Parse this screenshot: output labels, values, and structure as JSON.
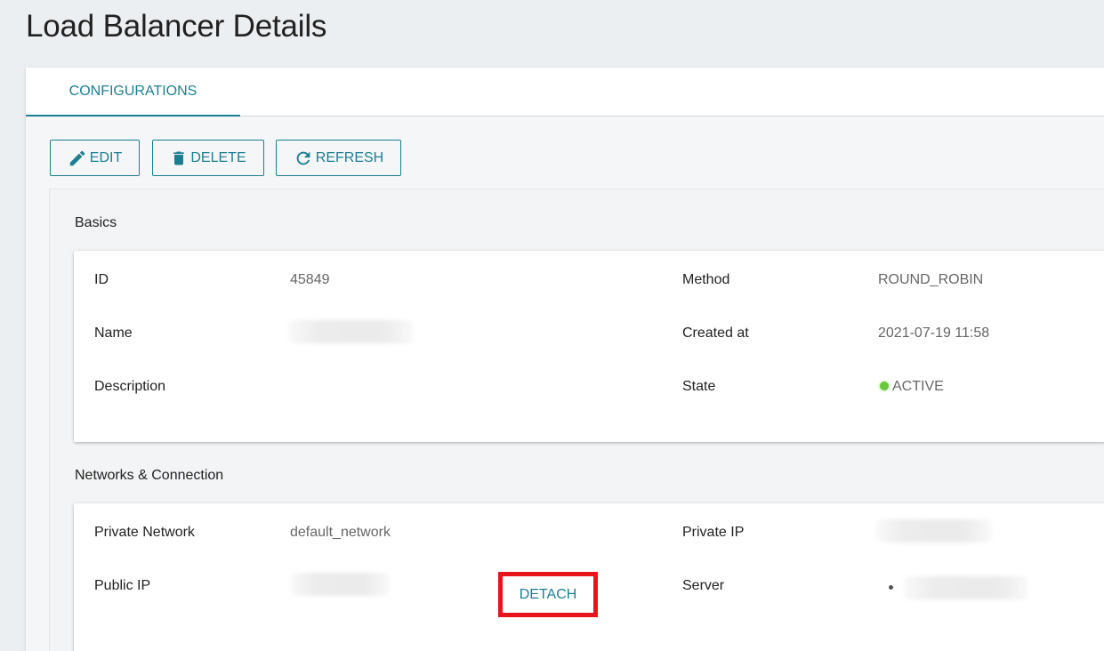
{
  "page": {
    "title": "Load Balancer Details"
  },
  "tabs": [
    {
      "label": "CONFIGURATIONS",
      "active": true
    }
  ],
  "toolbar": {
    "edit_label": "EDIT",
    "delete_label": "DELETE",
    "refresh_label": "REFRESH"
  },
  "basics": {
    "title": "Basics",
    "id_label": "ID",
    "id_value": "45849",
    "name_label": "Name",
    "name_value": "",
    "description_label": "Description",
    "description_value": "",
    "method_label": "Method",
    "method_value": "ROUND_ROBIN",
    "created_label": "Created at",
    "created_value": "2021-07-19 11:58",
    "state_label": "State",
    "state_value": "ACTIVE",
    "state_color": "#66c93a"
  },
  "network": {
    "title": "Networks & Connection",
    "private_network_label": "Private Network",
    "private_network_value": "default_network",
    "public_ip_label": "Public IP",
    "public_ip_value": "",
    "detach_label": "DETACH",
    "private_ip_label": "Private IP",
    "private_ip_value": "",
    "server_label": "Server",
    "server_values": [
      ""
    ]
  },
  "colors": {
    "accent": "#1b7f93",
    "highlight_border": "#e8141c",
    "page_background": "#eceff1"
  },
  "icons": {
    "edit": "pencil-icon",
    "delete": "trash-icon",
    "refresh": "refresh-icon"
  }
}
